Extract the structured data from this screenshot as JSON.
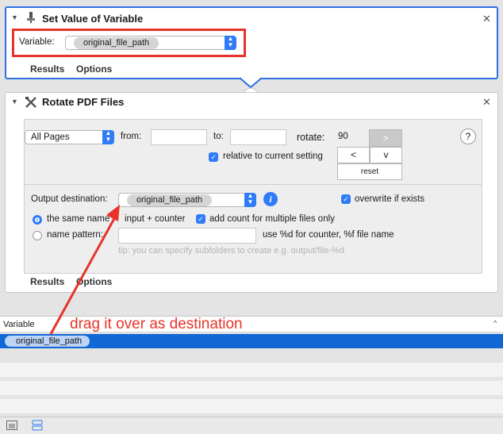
{
  "set_value": {
    "title": "Set Value of Variable",
    "variable_label": "Variable:",
    "variable_value": "original_file_path",
    "tabs": [
      "Results",
      "Options"
    ]
  },
  "rotate": {
    "title": "Rotate PDF Files",
    "pages_value": "All Pages",
    "from_label": "from:",
    "to_label": "to:",
    "rotate_label": "rotate:",
    "rotate_value": "90",
    "btn_right": ">",
    "btn_left": "<",
    "btn_down": "v",
    "btn_reset": "reset",
    "help": "?",
    "relative_label": "relative to current setting",
    "output_label": "Output destination:",
    "output_value": "original_file_path",
    "info": "i",
    "overwrite_label": "overwrite if exists",
    "same_name_a": "the same name",
    "same_name_b": "input + counter",
    "add_count_label": "add count for multiple files only",
    "name_pattern_label": "name pattern:",
    "pattern_hint": "use %d for counter, %f file name",
    "tip": "tip: you can specify subfolders to create e.g. output/file-%d",
    "tabs": [
      "Results",
      "Options"
    ]
  },
  "variables": {
    "header": "Variable",
    "selected": "original_file_path"
  },
  "annotation": {
    "text": "drag it over as destination",
    "color": "#e8332a"
  }
}
